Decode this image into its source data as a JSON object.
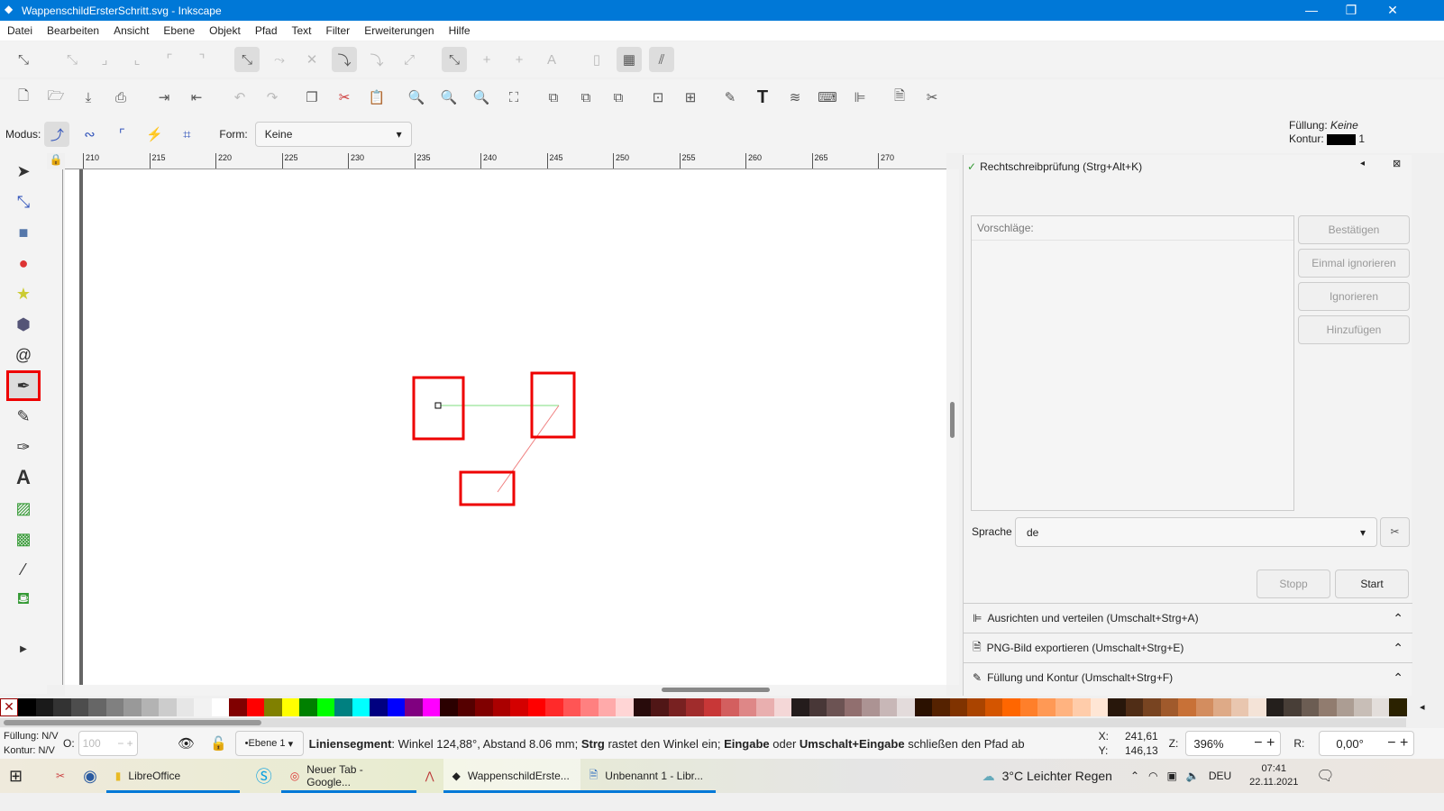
{
  "window": {
    "title": "WappenschildErsterSchritt.svg - Inkscape",
    "minimize": "—",
    "maximize": "❐",
    "close": "✕"
  },
  "menu": [
    "Datei",
    "Bearbeiten",
    "Ansicht",
    "Ebene",
    "Objekt",
    "Pfad",
    "Text",
    "Filter",
    "Erweiterungen",
    "Hilfe"
  ],
  "modebar": {
    "modus_label": "Modus:",
    "form_label": "Form:",
    "form_value": "Keine"
  },
  "style_indicator": {
    "fill_label": "Füllung:",
    "fill_value": "Keine",
    "stroke_label": "Kontur:",
    "stroke_width": "1"
  },
  "ruler": {
    "labels": [
      "210",
      "215",
      "220",
      "225",
      "230",
      "235",
      "240",
      "245",
      "250",
      "255",
      "260",
      "265",
      "270"
    ]
  },
  "panel": {
    "title": "Rechtschreibprüfung (Strg+Alt+K)",
    "suggestions_label": "Vorschläge:",
    "buttons": [
      "Bestätigen",
      "Einmal ignorieren",
      "Ignorieren",
      "Hinzufügen"
    ],
    "language_label": "Sprache",
    "language_value": "de",
    "stop": "Stopp",
    "start": "Start",
    "docks": [
      "Ausrichten und verteilen (Umschalt+Strg+A)",
      "PNG-Bild exportieren (Umschalt+Strg+E)",
      "Füllung und Kontur (Umschalt+Strg+F)"
    ]
  },
  "palette": [
    "#000000",
    "#1a1a1a",
    "#333333",
    "#4d4d4d",
    "#666666",
    "#808080",
    "#999999",
    "#b3b3b3",
    "#cccccc",
    "#e6e6e6",
    "#f2f2f2",
    "#ffffff",
    "#800000",
    "#ff0000",
    "#808000",
    "#ffff00",
    "#008000",
    "#00ff00",
    "#008080",
    "#00ffff",
    "#000080",
    "#0000ff",
    "#800080",
    "#ff00ff",
    "#2b0000",
    "#550000",
    "#800000",
    "#aa0000",
    "#d40000",
    "#ff0000",
    "#ff2a2a",
    "#ff5555",
    "#ff8080",
    "#ffaaaa",
    "#ffd5d5",
    "#280b0b",
    "#501616",
    "#782121",
    "#a02c2c",
    "#c83737",
    "#d35f5f",
    "#de8787",
    "#e9afaf",
    "#f4d7d7",
    "#241c1c",
    "#483737",
    "#6c5353",
    "#916f6f",
    "#ac9393",
    "#c8b7b7",
    "#e3dbdb",
    "#2b1100",
    "#552200",
    "#803300",
    "#aa4400",
    "#d45500",
    "#ff6600",
    "#ff7f2a",
    "#ff9955",
    "#ffb380",
    "#ffccaa",
    "#ffe6d5",
    "#28170b",
    "#502d16",
    "#784421",
    "#a05a2c",
    "#c87137",
    "#d38d5f",
    "#deaa87",
    "#e9c6af",
    "#f4e3d7",
    "#241f1c",
    "#483e37",
    "#6c5d53",
    "#917c6f",
    "#ac9d93",
    "#c8beb7",
    "#e3dedb",
    "#2b2200"
  ],
  "status": {
    "fill_label": "Füllung:",
    "fill_value": "N/V",
    "stroke_label": "Kontur:",
    "stroke_value": "N/V",
    "opacity_label": "O:",
    "opacity_value": "100",
    "layer": "•Ebene 1",
    "msg": [
      {
        "b": true,
        "t": "Liniensegment"
      },
      {
        "b": false,
        "t": ": Winkel 124,88°, Abstand 8.06 mm; "
      },
      {
        "b": true,
        "t": "Strg"
      },
      {
        "b": false,
        "t": " rastet den Winkel ein; "
      },
      {
        "b": true,
        "t": "Eingabe"
      },
      {
        "b": false,
        "t": " oder "
      },
      {
        "b": true,
        "t": "Umschalt+Eingabe"
      },
      {
        "b": false,
        "t": " schließen den Pfad ab"
      }
    ],
    "x_label": "X:",
    "x_value": "241,61",
    "y_label": "Y:",
    "y_value": "146,13",
    "zoom_label": "Z:",
    "zoom_value": "396%",
    "rot_label": "R:",
    "rot_value": "0,00°"
  },
  "taskbar": {
    "apps": [
      "LibreOffice",
      "Neuer Tab - Google...",
      "WappenschildErste...",
      "Unbenannt 1 - Libr..."
    ],
    "weather": "3°C  Leichter Regen",
    "lang": "DEU",
    "time": "07:41",
    "date": "22.11.2021"
  }
}
